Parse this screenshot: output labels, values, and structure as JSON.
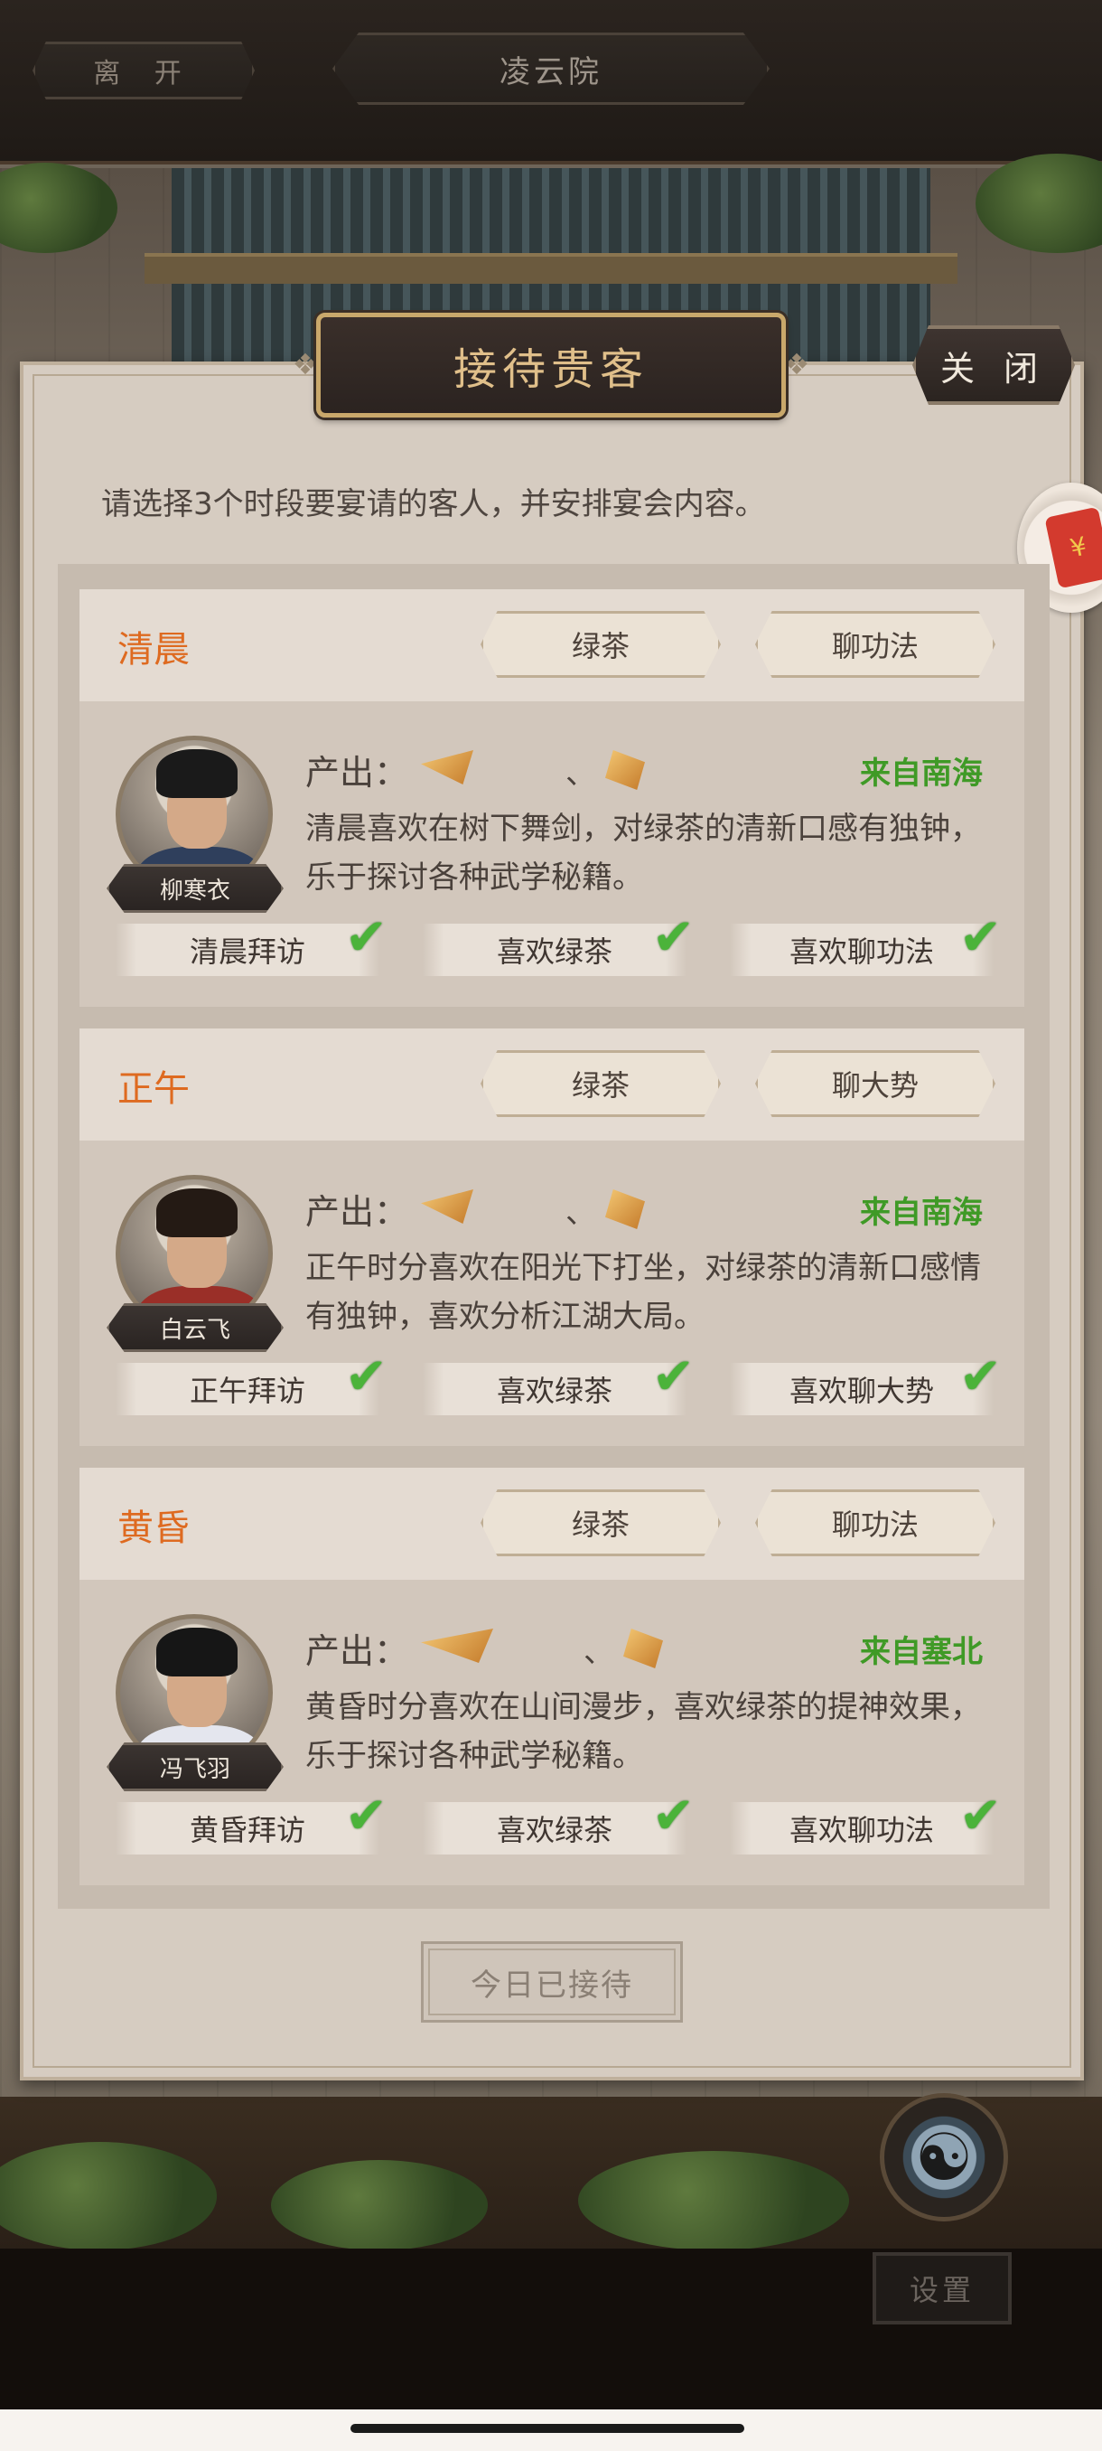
{
  "topbar": {
    "leave_label": "离 开",
    "location": "凌云院"
  },
  "dialog": {
    "title": "接待贵客",
    "close_label": "关 闭",
    "instruction": "请选择3个时段要宴请的客人，并安排宴会内容。",
    "output_prefix": "产出：",
    "separator": "、",
    "received_label": "今日已接待"
  },
  "guests": [
    {
      "slot": "清晨",
      "tags": [
        "绿茶",
        "聊功法"
      ],
      "name": "柳寒衣",
      "origin": "来自南海",
      "description": "清晨喜欢在树下舞剑，对绿茶的清新口感有独钟，乐于探讨各种武学秘籍。",
      "requirements": [
        "清晨拜访",
        "喜欢绿茶",
        "喜欢聊功法"
      ],
      "satisfied": [
        true,
        true,
        true
      ]
    },
    {
      "slot": "正午",
      "tags": [
        "绿茶",
        "聊大势"
      ],
      "name": "白云飞",
      "origin": "来自南海",
      "description": "正午时分喜欢在阳光下打坐，对绿茶的清新口感情有独钟，喜欢分析江湖大局。",
      "requirements": [
        "正午拜访",
        "喜欢绿茶",
        "喜欢聊大势"
      ],
      "satisfied": [
        true,
        true,
        true
      ]
    },
    {
      "slot": "黄昏",
      "tags": [
        "绿茶",
        "聊功法"
      ],
      "name": "冯飞羽",
      "origin": "来自塞北",
      "description": "黄昏时分喜欢在山间漫步，喜欢绿茶的提神效果，乐于探讨各种武学秘籍。",
      "requirements": [
        "黄昏拜访",
        "喜欢绿茶",
        "喜欢聊功法"
      ],
      "satisfied": [
        true,
        true,
        true
      ]
    }
  ],
  "footer": {
    "settings_label": "设置"
  },
  "colors": {
    "slot_label": "#de6a20",
    "origin": "#3f9a26",
    "check": "#4bb33a",
    "title_gold": "#e0bf8a"
  }
}
